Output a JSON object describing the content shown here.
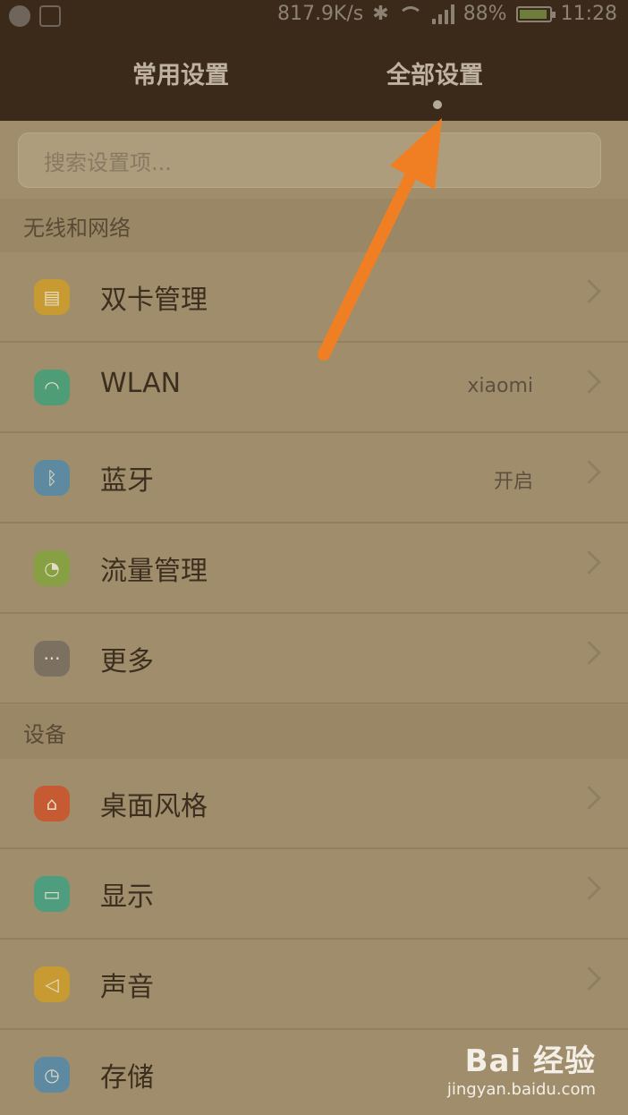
{
  "status_bar": {
    "speed": "817.9K/s",
    "battery": "88%",
    "time": "11:28",
    "icons": [
      "notification-icon",
      "image-icon",
      "bluetooth-icon",
      "wifi-icon",
      "signal-icon",
      "battery-icon"
    ]
  },
  "tabs": [
    {
      "label": "常用设置",
      "selected": false
    },
    {
      "label": "全部设置",
      "selected": true
    }
  ],
  "search": {
    "placeholder": "搜索设置项..."
  },
  "sections": [
    {
      "title": "无线和网络",
      "items": [
        {
          "label": "双卡管理",
          "value": "",
          "icon": "sim-card-icon",
          "color": "#c79b32"
        },
        {
          "label": "WLAN",
          "value": "xiaomi",
          "icon": "wifi-icon",
          "color": "#4f9d77"
        },
        {
          "label": "蓝牙",
          "value": "开启",
          "icon": "bluetooth-icon",
          "color": "#5d8aa0"
        },
        {
          "label": "流量管理",
          "value": "",
          "icon": "data-usage-icon",
          "color": "#86a043"
        },
        {
          "label": "更多",
          "value": "",
          "icon": "more-icon",
          "color": "#7c7060"
        }
      ]
    },
    {
      "title": "设备",
      "items": [
        {
          "label": "桌面风格",
          "value": "",
          "icon": "home-icon",
          "color": "#c65a33"
        },
        {
          "label": "显示",
          "value": "",
          "icon": "display-icon",
          "color": "#4f9d7f"
        },
        {
          "label": "声音",
          "value": "",
          "icon": "sound-icon",
          "color": "#c79b32"
        },
        {
          "label": "存储",
          "value": "",
          "icon": "storage-icon",
          "color": "#5d8aa0"
        }
      ]
    }
  ],
  "watermark": {
    "logo": "Bai 经验",
    "url": "jingyan.baidu.com"
  },
  "colors": {
    "header": "#3b2a19",
    "arrow": "#f07f24",
    "background": "#a08d6c"
  }
}
